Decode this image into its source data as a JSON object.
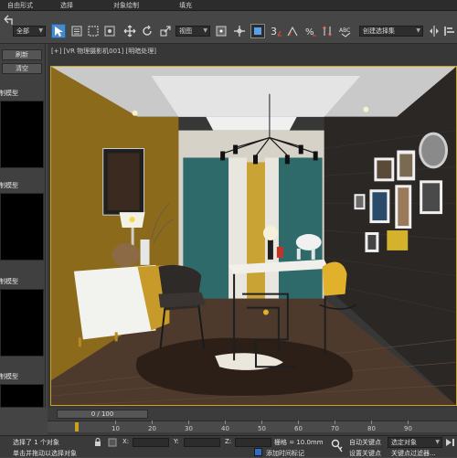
{
  "menubar": {
    "items": [
      "自由形式",
      "选择",
      "对象绘制",
      "填充"
    ]
  },
  "toolbar": {
    "selection_filter": "全部",
    "reference_coord": "视图",
    "named_selection": "创建选择集",
    "icons": [
      "undo-icon",
      "select-object-icon",
      "select-by-name-icon",
      "rect-region-icon",
      "window-crossing-icon",
      "move-icon",
      "rotate-icon",
      "scale-icon",
      "pivot-center-icon",
      "select-link-icon",
      "snap-toggle-icon",
      "angle-snap-icon",
      "percent-snap-icon",
      "spinner-snap-icon",
      "edit-named-selection-icon",
      "mirror-icon",
      "align-icon"
    ]
  },
  "left_panel": {
    "refresh_label": "刷新",
    "clear_label": "清空",
    "section_label": "复制模型"
  },
  "viewport": {
    "label": "[+] [VR 物理摄影机001] [明暗处理]"
  },
  "timeline": {
    "slider_label": "0 / 100",
    "ticks": [
      "10",
      "20",
      "30",
      "40",
      "50",
      "60",
      "70",
      "80",
      "90"
    ]
  },
  "statusbar": {
    "selection_text": "选择了 1 个对象",
    "prompt_text": "单击并拖动以选择对象",
    "x_label": "X:",
    "y_label": "Y:",
    "z_label": "Z:",
    "grid_text": "栅格 = 10.0mm",
    "add_time_tag": "添加时间标记",
    "auto_key_label": "自动关键点",
    "set_key_label": "设置关键点",
    "key_filter_select": "选定对象",
    "key_filters_label": "关键点过滤器..."
  },
  "colors": {
    "ui_bg": "#444444",
    "viewport_border": "#c9a21b",
    "wall_mustard": "#8c6a1c",
    "wall_brick": "#2a2725",
    "curtain_teal": "#2f6a6a",
    "accent_yellow": "#e2b12c"
  }
}
